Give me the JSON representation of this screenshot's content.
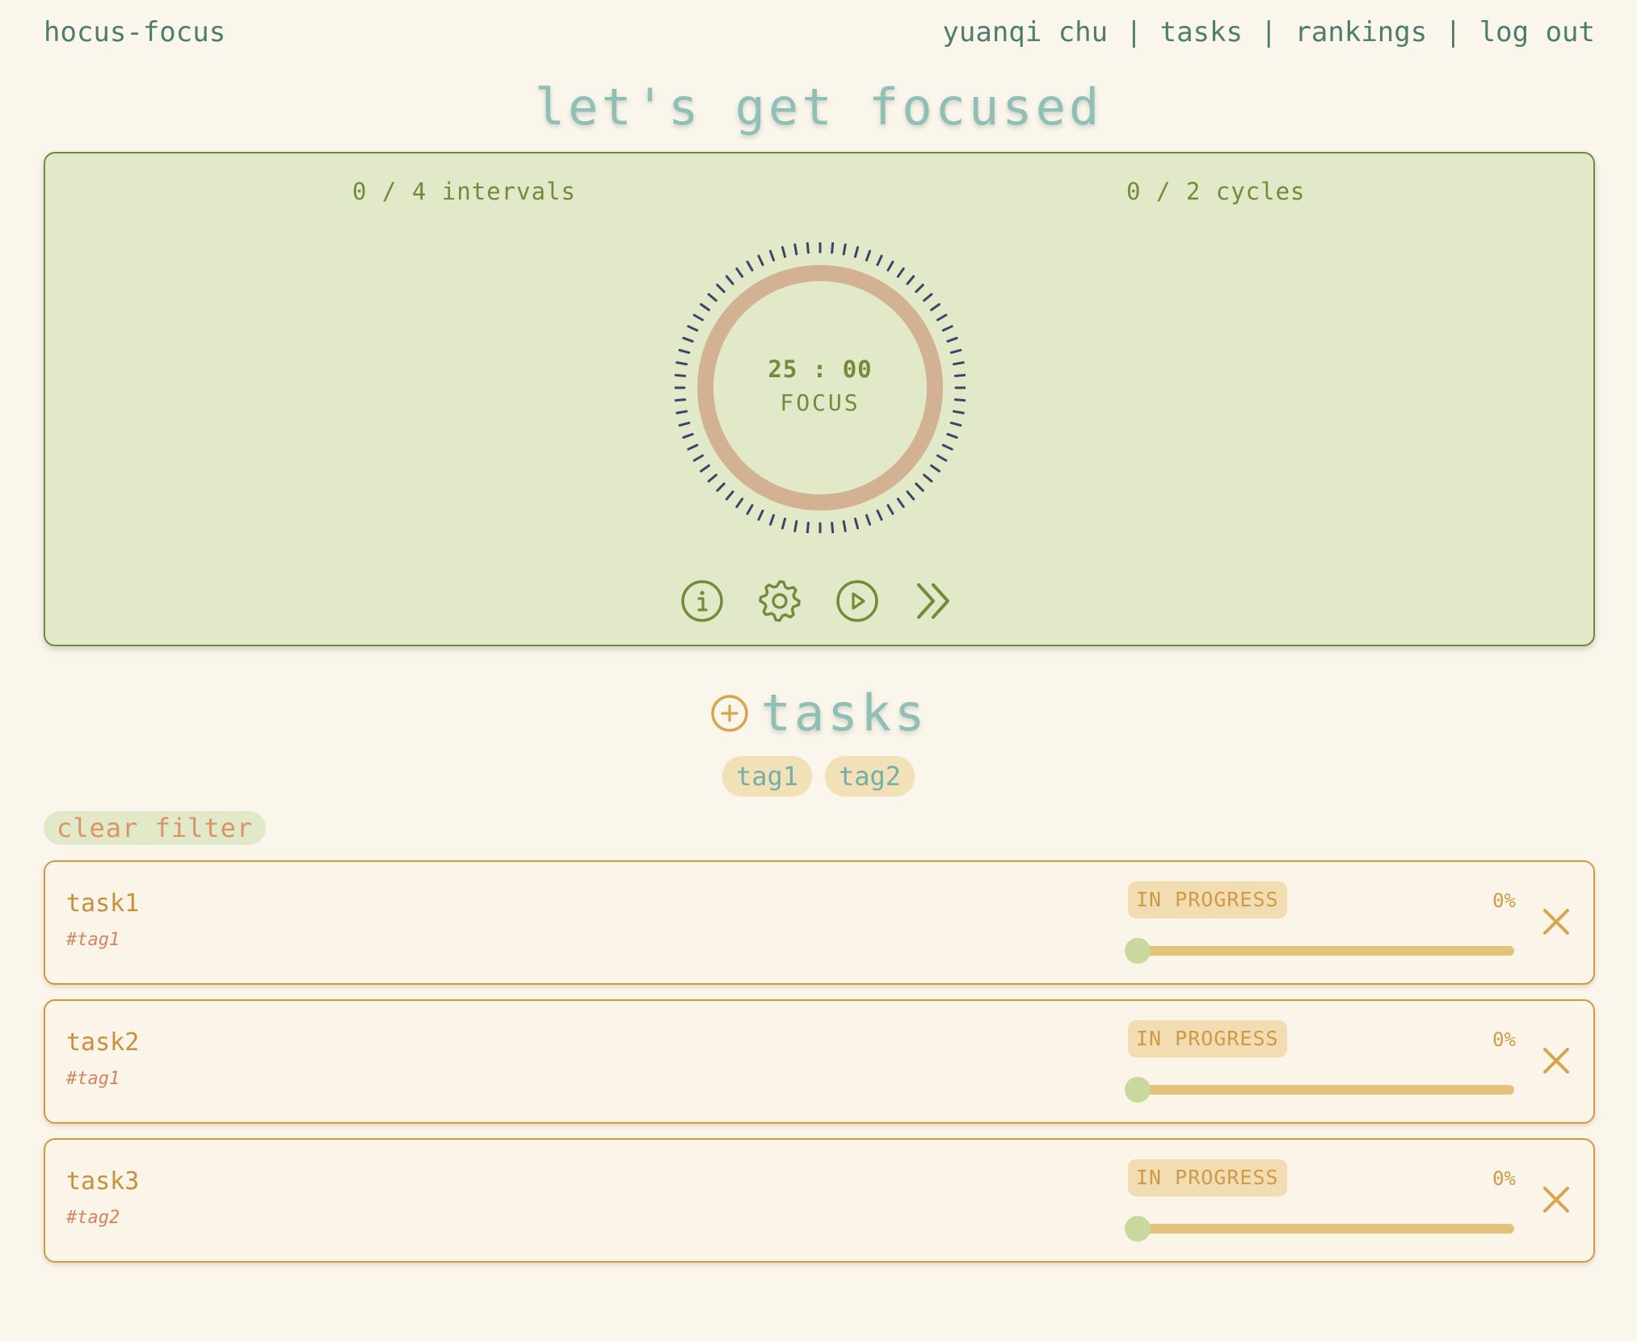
{
  "header": {
    "brand": "hocus-focus",
    "nav": {
      "user": "yuanqi chu",
      "sep": "|",
      "tasks": "tasks",
      "rankings": "rankings",
      "logout": "log out"
    },
    "title": "let's get focused"
  },
  "timer": {
    "intervals_text": "0 / 4 intervals",
    "cycles_text": "0 / 2 cycles",
    "time": "25 : 00",
    "mode": "FOCUS",
    "controls": [
      "info-icon",
      "gear-icon",
      "play-icon",
      "skip-forward-icon"
    ]
  },
  "tasks_section": {
    "title": "tasks",
    "add_icon": "plus-circle-icon",
    "tags": [
      "tag1",
      "tag2"
    ],
    "clear_filter": "clear filter",
    "items": [
      {
        "name": "task1",
        "tag": "#tag1",
        "status": "IN PROGRESS",
        "progress": "0%"
      },
      {
        "name": "task2",
        "tag": "#tag1",
        "status": "IN PROGRESS",
        "progress": "0%"
      },
      {
        "name": "task3",
        "tag": "#tag2",
        "status": "IN PROGRESS",
        "progress": "0%"
      }
    ]
  },
  "colors": {
    "background": "#fbf6ec",
    "teal_text": "#4e7c6f",
    "title_teal": "#90bfb8",
    "panel_green": "#e2e9c8",
    "olive": "#758a3a",
    "ring": "#d3b293",
    "ticks": "#3d4466",
    "task_orange": "#cf9a48",
    "slider_track": "#e5c27a",
    "slider_thumb": "#c9d89c"
  }
}
